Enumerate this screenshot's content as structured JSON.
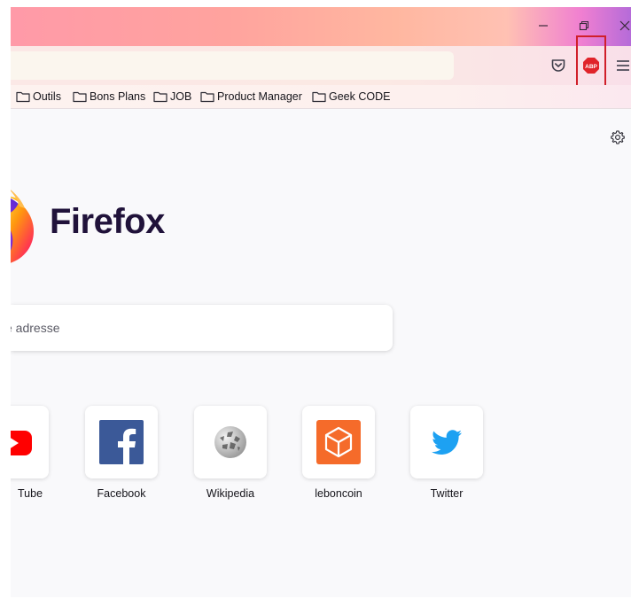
{
  "window": {
    "controls": [
      "minimize-icon",
      "restore-icon",
      "close-icon"
    ]
  },
  "toolbar": {
    "icons": [
      "pocket-icon",
      "adblock-plus-icon",
      "hamburger-menu-icon"
    ],
    "abp_badge": "ABP"
  },
  "bookmarks": [
    {
      "label": "Outils",
      "icon": "folder-icon"
    },
    {
      "label": "Bons Plans",
      "icon": "folder-icon"
    },
    {
      "label": "JOB",
      "icon": "folder-icon"
    },
    {
      "label": "Product Manager",
      "icon": "folder-icon"
    },
    {
      "label": "Geek CODE",
      "icon": "folder-icon"
    }
  ],
  "newtab": {
    "brand": "Firefox",
    "search_placeholder": "e adresse",
    "settings_icon": "gear-icon"
  },
  "top_sites": [
    {
      "label": "Tube",
      "icon": "youtube-icon",
      "color": "#ff0000"
    },
    {
      "label": "Facebook",
      "icon": "facebook-icon",
      "color": "#3b5998"
    },
    {
      "label": "Wikipedia",
      "icon": "wikipedia-icon",
      "color": "#6b6b6b"
    },
    {
      "label": "leboncoin",
      "icon": "leboncoin-icon",
      "color": "#f56b2a"
    },
    {
      "label": "Twitter",
      "icon": "twitter-icon",
      "color": "#1da1f2"
    }
  ],
  "colors": {
    "highlight": "#d01f2a",
    "abp_red": "#e0232a",
    "brand_text": "#20123a"
  }
}
